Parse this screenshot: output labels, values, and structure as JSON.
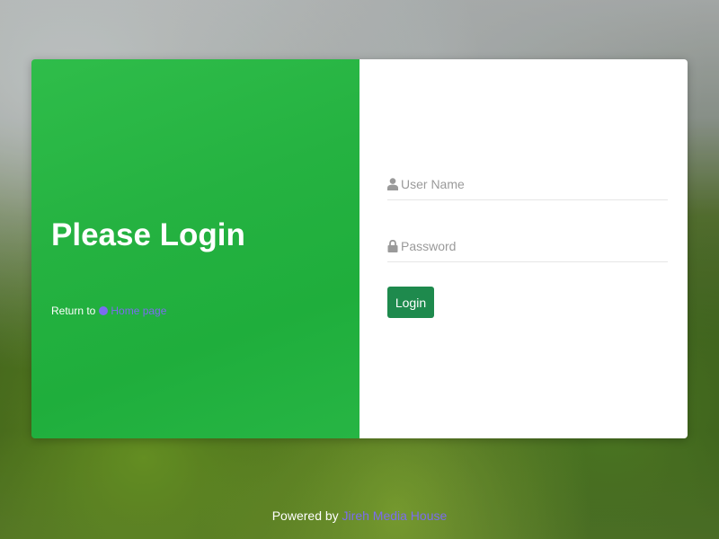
{
  "left": {
    "title": "Please Login",
    "return_text": "Return to",
    "home_link_label": "Home page"
  },
  "form": {
    "username_placeholder": "User Name",
    "password_placeholder": "Password",
    "login_label": "Login",
    "user_icon": "user-icon",
    "lock_icon": "lock-icon"
  },
  "footer": {
    "powered_text": "Powered by",
    "company_link": "Jireh Media House"
  },
  "colors": {
    "panel_green": "#25b241",
    "button_green": "#1e8a4d",
    "link_purple": "#7b6cf0"
  }
}
